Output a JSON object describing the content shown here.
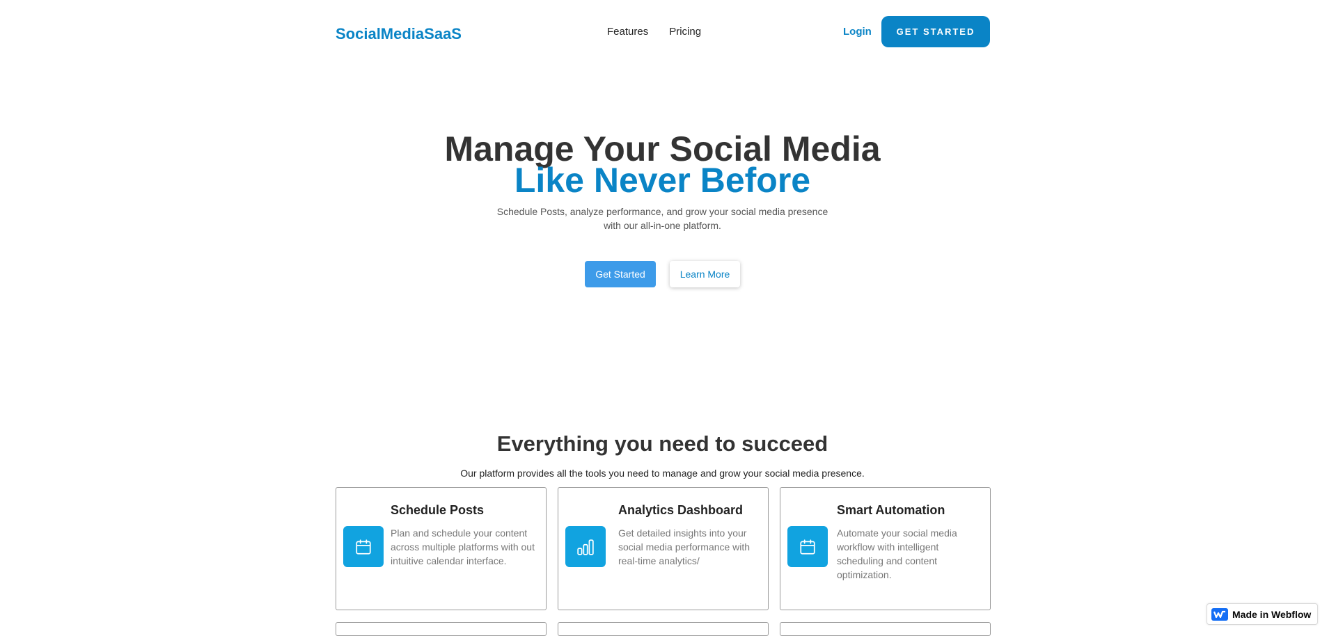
{
  "nav": {
    "logo": "SocialMediaSaaS",
    "links": [
      "Features",
      "Pricing"
    ],
    "login": "Login",
    "cta": "GET STARTED"
  },
  "hero": {
    "title_line1": "Manage Your Social Media",
    "title_line2": "Like Never Before",
    "subtitle_line1": "Schedule Posts, analyze performance, and grow your social media presence",
    "subtitle_line2": "with our all-in-one platform.",
    "primary_button": "Get Started",
    "secondary_button": "Learn More"
  },
  "features": {
    "title": "Everything you need to succeed",
    "subtitle": "Our platform provides all the tools you need to manage and grow your social media presence.",
    "cards": [
      {
        "title": "Schedule Posts",
        "description": "Plan and schedule your content across multiple platforms with out intuitive calendar interface.",
        "icon": "calendar-icon"
      },
      {
        "title": "Analytics Dashboard",
        "description": "Get detailed insights into your social media performance with real-time analytics/",
        "icon": "bar-chart-icon"
      },
      {
        "title": "Smart Automation",
        "description": "Automate your social media workflow with intelligent scheduling and content optimization.",
        "icon": "calendar-icon"
      }
    ]
  },
  "badge": {
    "label": "Made in Webflow",
    "icon": "webflow-logo-icon"
  },
  "colors": {
    "brand": "#0a84c6",
    "primary_button": "#3d9be9",
    "icon_tile": "#11a3e0",
    "heading": "#333333"
  }
}
